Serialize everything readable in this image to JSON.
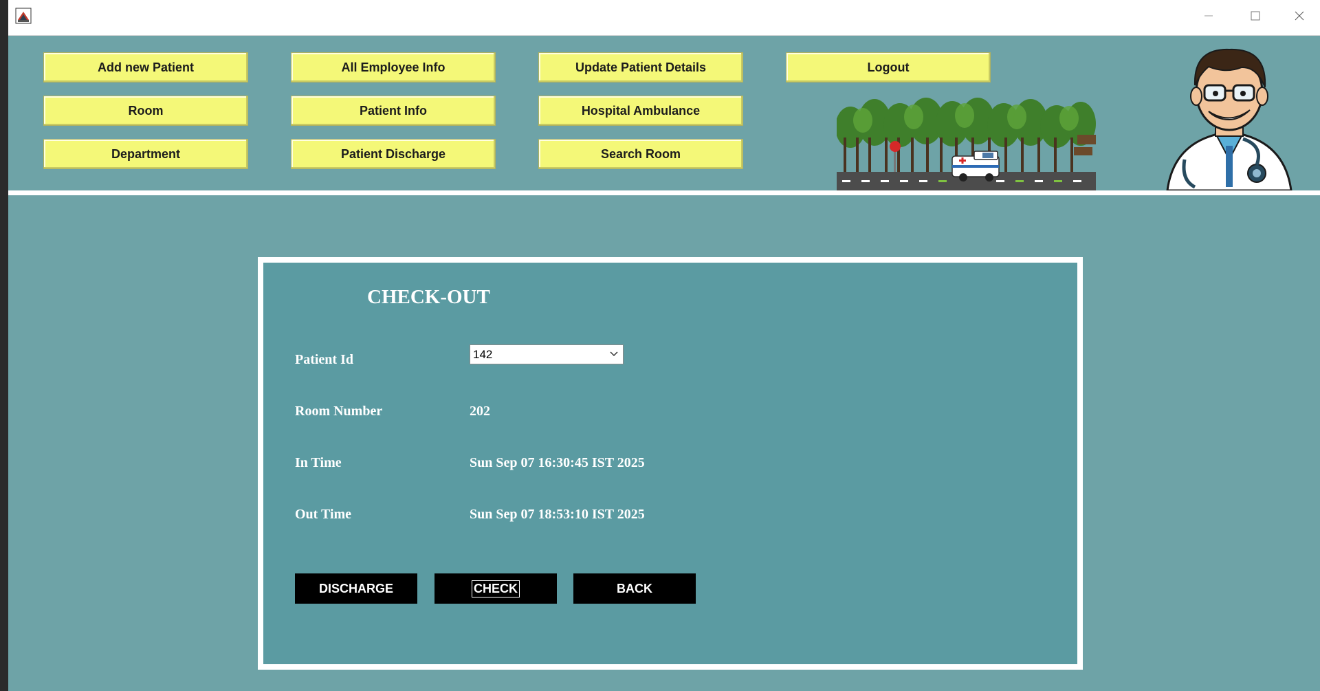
{
  "nav": {
    "row1": [
      "Add new Patient",
      "All Employee Info",
      "Update Patient Details",
      "Logout"
    ],
    "row2": [
      "Room",
      "Patient Info",
      "Hospital Ambulance"
    ],
    "row3": [
      "Department",
      "Patient Discharge",
      "Search Room"
    ]
  },
  "checkout": {
    "title": "CHECK-OUT",
    "patient_id_label": "Patient Id",
    "patient_id_value": "142",
    "room_number_label": "Room Number",
    "room_number_value": "202",
    "in_time_label": "In Time",
    "in_time_value": "Sun Sep 07 16:30:45 IST 2025",
    "out_time_label": "Out Time",
    "out_time_value": "Sun Sep 07 18:53:10 IST 2025"
  },
  "actions": {
    "discharge": "DISCHARGE",
    "check": "CHECK",
    "back": "BACK"
  },
  "colors": {
    "background": "#6ea3a7",
    "panel": "#5b9ba2",
    "nav_button": "#f4f878",
    "action_button": "#000000"
  },
  "icons": {
    "app": "java-app-icon",
    "minimize": "minimize-icon",
    "maximize": "maximize-icon",
    "close": "close-icon",
    "dropdown": "chevron-down-icon"
  }
}
